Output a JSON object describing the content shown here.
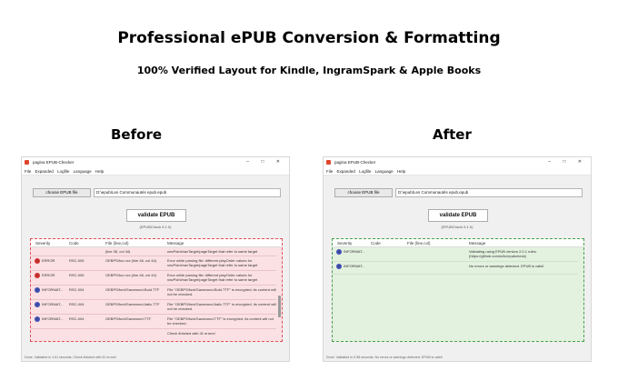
{
  "headline": "Professional ePUB Conversion & Formatting",
  "subheadline": "100% Verified Layout for Kindle, IngramSpark & Apple Books",
  "panels": {
    "before": {
      "label": "Before",
      "window_title": "pagina EPUB-Checker",
      "window_controls": "– □ ✕",
      "menu": [
        "File",
        "Expanded",
        "Logfile",
        "Language",
        "Help"
      ],
      "choose_button": "choose EPUB file",
      "path": "D:\\epub\\Les Communautés epub.epub",
      "validate_button": "validate EPUB",
      "version": "(EPUBCheck 5.1.0)",
      "columns": [
        "Severity",
        "Code",
        "File (line,col)",
        "Message"
      ],
      "rows": [
        {
          "icon": "",
          "severity": "",
          "code": "",
          "file": "(line 36, col 44)",
          "message": "navPoint/navTarget/pageTarget that refer to same target"
        },
        {
          "icon": "error",
          "severity": "ERROR",
          "code": "RSC-005",
          "file": "OEBPS/toc.ncx (line 46, col 44)",
          "message": "Error while parsing file: different playOrder values for navPoint/navTarget/pageTarget that refer to same target"
        },
        {
          "icon": "error",
          "severity": "ERROR",
          "code": "RSC-005",
          "file": "OEBPS/toc.ncx (line 46, col 44)",
          "message": "Error while parsing file: different playOrder values for navPoint/navTarget/pageTarget that refer to same target"
        },
        {
          "icon": "info",
          "severity": "INFORMAT...",
          "code": "RSC-004",
          "file": "OEBPS/font/Garamond-Bold.TTF",
          "message": "File \"OEBPS/font/Garamond-Bold.TTF\" is encrypted, its content will not be checked."
        },
        {
          "icon": "info",
          "severity": "INFORMAT...",
          "code": "RSC-004",
          "file": "OEBPS/font/Garamond-Italic.TTF",
          "message": "File \"OEBPS/font/Garamond-Italic.TTF\" is encrypted, its content will not be checked."
        },
        {
          "icon": "info",
          "severity": "INFORMAT...",
          "code": "RSC-004",
          "file": "OEBPS/font/Garamond.TTF",
          "message": "File \"OEBPS/font/Garamond.TTF\" is encrypted, its content will not be checked."
        },
        {
          "icon": "",
          "severity": "",
          "code": "",
          "file": "",
          "message": "Check finished with 41 errors!"
        }
      ],
      "status": "Done. Validated in 1.61 seconds. Check finished with 41 errors!"
    },
    "after": {
      "label": "After",
      "window_title": "pagina EPUB-Checker",
      "window_controls": "– □ ✕",
      "menu": [
        "File",
        "Expanded",
        "Logfile",
        "Language",
        "Help"
      ],
      "choose_button": "choose EPUB file",
      "path": "D:\\epub\\Les Communautés epub.epub",
      "validate_button": "validate EPUB",
      "version": "(EPUBCheck 5.1.0)",
      "columns": [
        "Severity",
        "Code",
        "File (line,col)",
        "Message"
      ],
      "rows": [
        {
          "icon": "info",
          "severity": "INFORMAT...",
          "code": "",
          "file": "",
          "message": "Validating using EPUB version 2.0.1 rules. (https://github.com/w3c/epubcheck)"
        },
        {
          "icon": "info",
          "severity": "INFORMAT...",
          "code": "",
          "file": "",
          "message": "No errors or warnings detected. EPUB is valid!"
        }
      ],
      "status": "Done. Validated in 0.58 seconds. No errors or warnings detected. EPUB is valid!"
    }
  },
  "colors": {
    "before_border": "#e0505a",
    "before_fill": "#fbe1e3",
    "after_border": "#49a14e",
    "after_fill": "#e3f1df",
    "error_icon": "#d32f2f",
    "info_icon": "#3f51b5"
  }
}
